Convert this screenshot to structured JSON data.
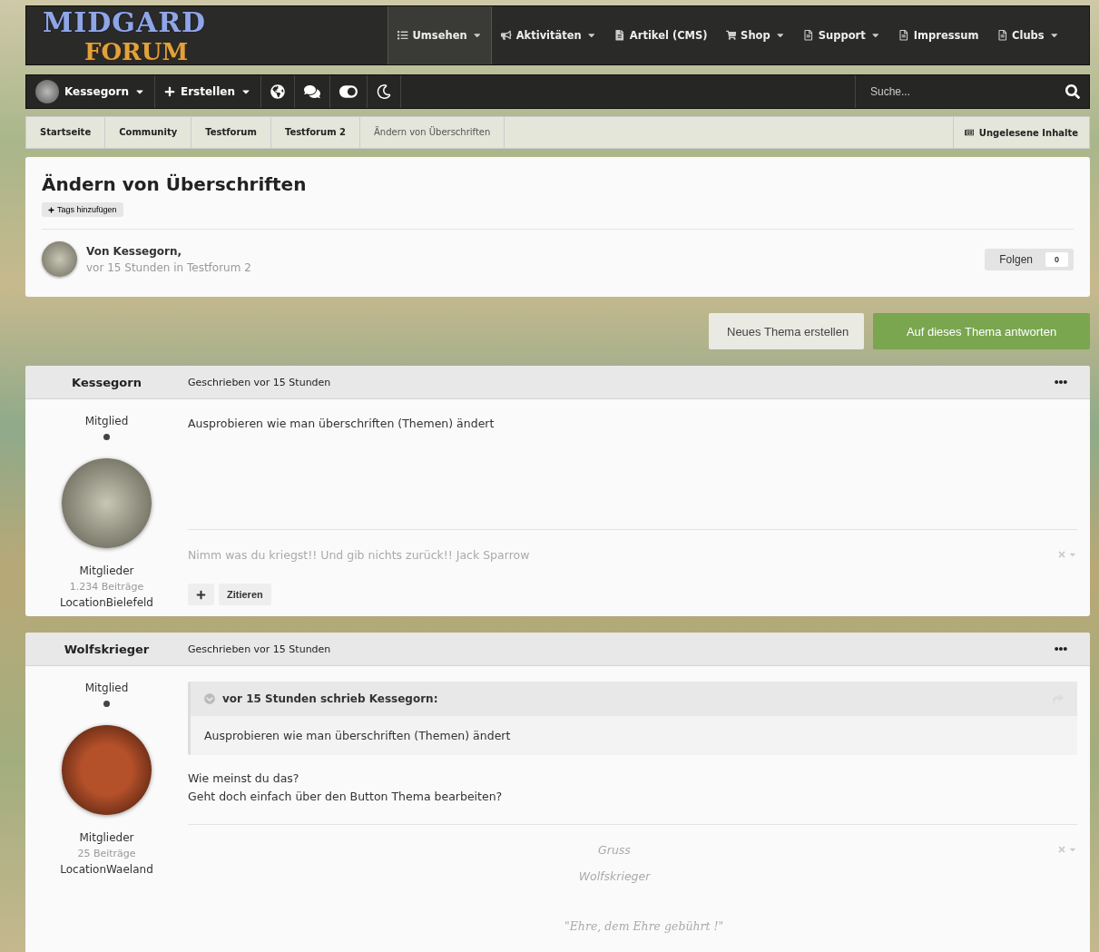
{
  "logo": {
    "line_1": "MIDGARD",
    "line_2": "FORUM"
  },
  "main_nav": [
    {
      "label": "Umsehen",
      "selected": true,
      "dropdown": true
    },
    {
      "label": "Aktivitäten",
      "selected": false,
      "dropdown": true
    },
    {
      "label": "Artikel (CMS)",
      "selected": false,
      "dropdown": false
    },
    {
      "label": "Shop",
      "selected": false,
      "dropdown": true
    },
    {
      "label": "Support",
      "selected": false,
      "dropdown": true
    },
    {
      "label": "Impressum",
      "selected": false,
      "dropdown": false
    },
    {
      "label": "Clubs",
      "selected": false,
      "dropdown": true
    }
  ],
  "user_bar": {
    "username": "Kessegorn",
    "create_label": "Erstellen"
  },
  "search": {
    "placeholder": "Suche..."
  },
  "breadcrumbs": [
    "Startseite",
    "Community",
    "Testforum",
    "Testforum 2",
    "Ändern von Überschriften"
  ],
  "unread_link": "Ungelesene Inhalte",
  "topic": {
    "title": "Ändern von Überschriften",
    "tag_button": "Tags hinzufügen",
    "author_line": "Von Kessegorn,",
    "meta": "vor 15 Stunden in Testforum 2",
    "follow_label": "Folgen",
    "follow_count": "0"
  },
  "actions": [
    {
      "label": "Neues Thema erstellen",
      "kind": "secondary"
    },
    {
      "label": "Auf dieses Thema antworten",
      "kind": "primary"
    }
  ],
  "posts": [
    {
      "author": "Kessegorn",
      "date": "Geschrieben vor 15 Stunden",
      "rank": "Mitglied",
      "group": "Mitglieder",
      "post_count": "1.234 Beiträge",
      "location": "LocationBielefeld",
      "body": [
        "Ausprobieren wie man überschriften (Themen) ändert"
      ],
      "signature": [
        {
          "text": "Nimm was du kriegst!! Und gib nichts zurück!! Jack Sparrow",
          "kind": "plain"
        }
      ],
      "quote_button": "Zitieren"
    },
    {
      "author": "Wolfskrieger",
      "date": "Geschrieben vor 15 Stunden",
      "rank": "Mitglied",
      "group": "Mitglieder",
      "post_count": "25 Beiträge",
      "location": "LocationWaeland",
      "quote": {
        "header": "vor 15 Stunden schrieb Kessegorn:",
        "text": "Ausprobieren wie man überschriften (Themen) ändert"
      },
      "body": [
        "Wie meinst du das?",
        "Geht doch einfach über den Button Thema bearbeiten?"
      ],
      "signature": [
        {
          "text": "Gruss",
          "kind": "centered"
        },
        {
          "text": "Wolfskrieger",
          "kind": "centered"
        },
        {
          "text": "\"Ehre, dem Ehre gebührt !\"",
          "kind": "serif"
        }
      ]
    }
  ]
}
